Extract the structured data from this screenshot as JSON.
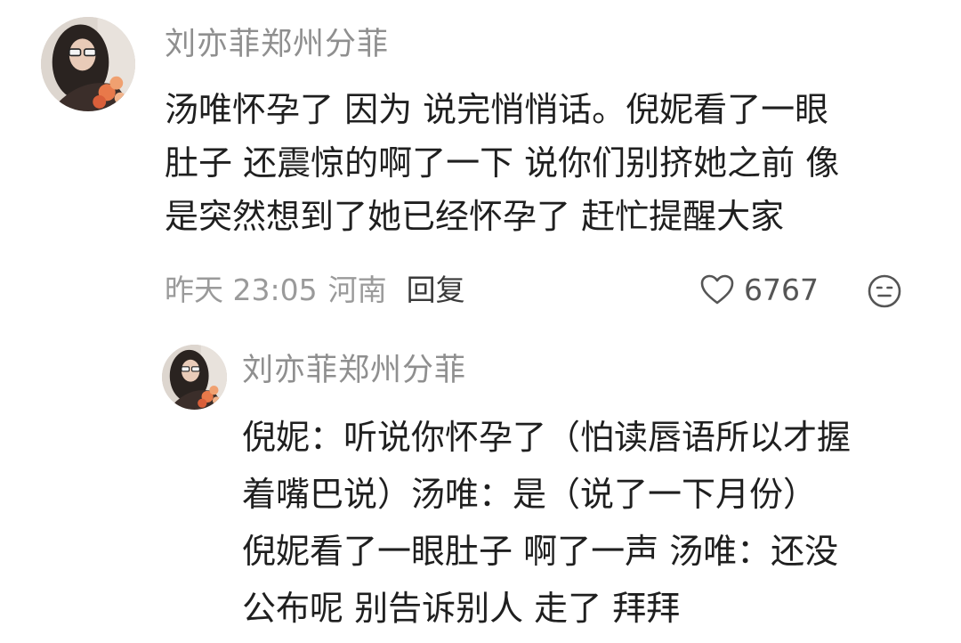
{
  "comment": {
    "username": "刘亦菲郑州分菲",
    "lines": [
      "汤唯怀孕了 因为 说完悄悄话。倪妮看了一眼",
      "肚子 还震惊的啊了一下 说你们别挤她之前 像",
      "是突然想到了她已经怀孕了 赶忙提醒大家"
    ],
    "time": "昨天 23:05",
    "location": "河南",
    "reply_label": "回复",
    "like_count": "6767",
    "like_icon": "heart-outline-icon",
    "emoji_icon": "smiley-face-icon"
  },
  "reply": {
    "username": "刘亦菲郑州分菲",
    "lines": [
      "倪妮：听说你怀孕了（怕读唇语所以才握",
      "着嘴巴说）汤唯：是（说了一下月份）",
      "倪妮看了一眼肚子 啊了一声 汤唯：还没",
      "公布呢 别告诉别人 走了 拜拜"
    ]
  },
  "colors": {
    "username": "#8f8f8f",
    "text": "#1f1f1f",
    "meta": "#9a9a9a"
  }
}
